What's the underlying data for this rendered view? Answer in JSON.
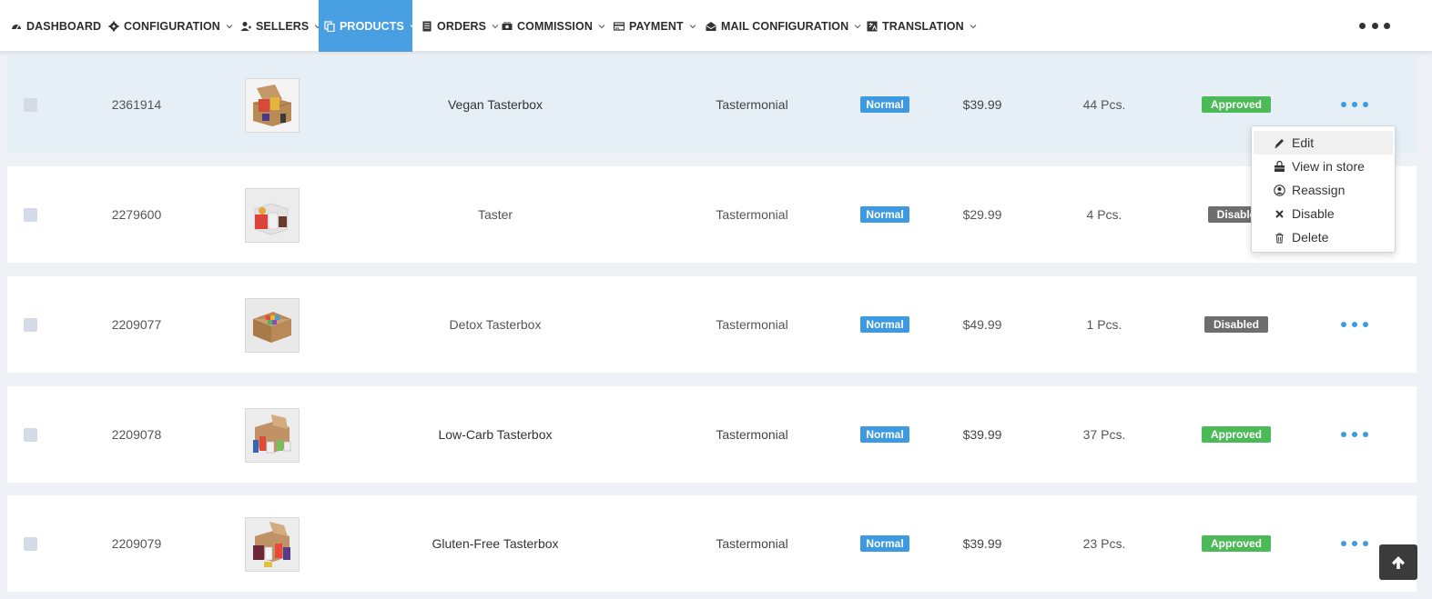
{
  "nav": {
    "items": [
      {
        "label": "DASHBOARD",
        "icon": "dashboard-icon",
        "active": false
      },
      {
        "label": "CONFIGURATION",
        "icon": "gear-icon",
        "active": false
      },
      {
        "label": "SELLERS",
        "icon": "users-icon",
        "active": false
      },
      {
        "label": "PRODUCTS",
        "icon": "copy-icon",
        "active": true
      },
      {
        "label": "ORDERS",
        "icon": "list-icon",
        "active": false
      },
      {
        "label": "COMMISSION",
        "icon": "money-icon",
        "active": false
      },
      {
        "label": "PAYMENT",
        "icon": "credit-card-icon",
        "active": false
      },
      {
        "label": "MAIL CONFIGURATION",
        "icon": "envelope-icon",
        "active": false
      },
      {
        "label": "TRANSLATION",
        "icon": "language-icon",
        "active": false
      }
    ]
  },
  "products": [
    {
      "id": "2361914",
      "name": "Vegan Tasterbox",
      "seller": "Tastermonial",
      "type": "Normal",
      "price": "$39.99",
      "quantity": "44 Pcs.",
      "status": "Approved"
    },
    {
      "id": "2279600",
      "name": "Taster",
      "seller": "Tastermonial",
      "type": "Normal",
      "price": "$29.99",
      "quantity": "4 Pcs.",
      "status": "Disable"
    },
    {
      "id": "2209077",
      "name": "Detox Tasterbox",
      "seller": "Tastermonial",
      "type": "Normal",
      "price": "$49.99",
      "quantity": "1 Pcs.",
      "status": "Disabled"
    },
    {
      "id": "2209078",
      "name": "Low-Carb Tasterbox",
      "seller": "Tastermonial",
      "type": "Normal",
      "price": "$39.99",
      "quantity": "37 Pcs.",
      "status": "Approved"
    },
    {
      "id": "2209079",
      "name": "Gluten-Free Tasterbox",
      "seller": "Tastermonial",
      "type": "Normal",
      "price": "$39.99",
      "quantity": "23 Pcs.",
      "status": "Approved"
    }
  ],
  "row_menu": {
    "items": [
      {
        "label": "Edit",
        "icon": "pencil-icon"
      },
      {
        "label": "View in store",
        "icon": "store-icon"
      },
      {
        "label": "Reassign",
        "icon": "user-circle-icon"
      },
      {
        "label": "Disable",
        "icon": "close-icon"
      },
      {
        "label": "Delete",
        "icon": "trash-icon"
      }
    ]
  },
  "colors": {
    "accent": "#48a0e3",
    "approved": "#4cba56",
    "disabled": "#6e6e6e",
    "row_highlight": "#e6eff6"
  }
}
